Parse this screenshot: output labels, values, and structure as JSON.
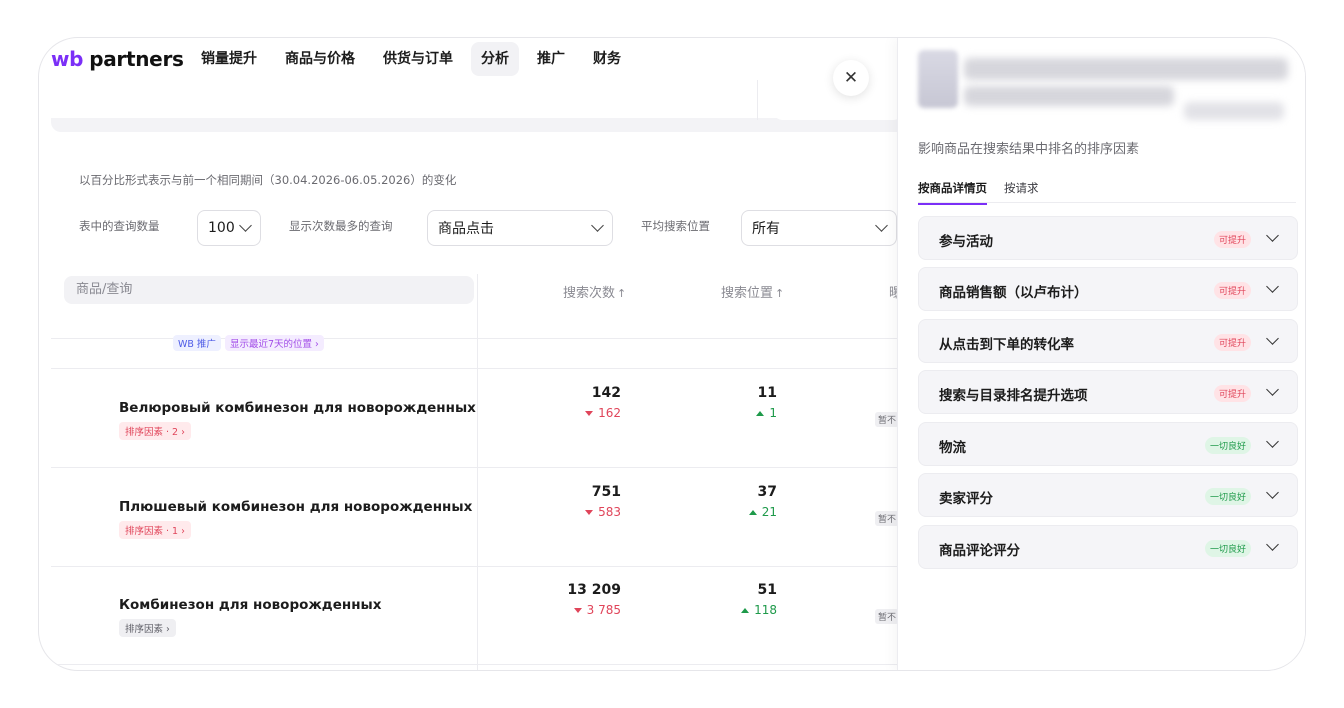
{
  "header": {
    "logo_mark": "wb",
    "logo_text": "partners",
    "nav": [
      "销量提升",
      "商品与价格",
      "供货与订单",
      "分析",
      "推广",
      "财务"
    ],
    "active_nav": "分析"
  },
  "filters": {
    "period_note": "以百分比形式表示与前一个相同期间（30.04.2026-06.05.2026）的变化",
    "rows_label": "表中的查询数量",
    "rows_value": "100",
    "top_label": "显示次数最多的查询",
    "top_value": "商品点击",
    "position_label": "平均搜索位置",
    "position_value": "所有"
  },
  "table": {
    "search_placeholder": "商品/查询",
    "col_searches": "搜索次数",
    "col_position": "搜索位置",
    "col_partial": "曝",
    "sort_arrow": "↑",
    "partial_tags": [
      "WB 推广",
      "显示最近7天的位置 ›"
    ],
    "rows": [
      {
        "name": "Велюровый комбинезон для новорожденных",
        "tag": "排序因素 · 2",
        "tag_color": "red",
        "searches": "142",
        "searches_delta": "162",
        "searches_dir": "down",
        "position": "11",
        "position_delta": "1",
        "position_dir": "up",
        "cut": "暂不"
      },
      {
        "name": "Плюшевый комбинезон для новорожденных",
        "tag": "排序因素 · 1",
        "tag_color": "red",
        "searches": "751",
        "searches_delta": "583",
        "searches_dir": "down",
        "position": "37",
        "position_delta": "21",
        "position_dir": "up",
        "cut": "暂不"
      },
      {
        "name": "Комбинезон для новорожденных",
        "tag": "排序因素",
        "tag_color": "grey",
        "searches": "13 209",
        "searches_delta": "3 785",
        "searches_dir": "down",
        "position": "51",
        "position_delta": "118",
        "position_dir": "up",
        "cut": "暂不"
      }
    ]
  },
  "panel": {
    "close_symbol": "✕",
    "subtitle": "影响商品在搜索结果中排名的排序因素",
    "tabs": [
      "按商品详情页",
      "按请求"
    ],
    "active_tab": "按商品详情页",
    "factors": [
      {
        "title": "参与活动",
        "badge": "可提升",
        "status": "red"
      },
      {
        "title": "商品销售额（以卢布计）",
        "badge": "可提升",
        "status": "red"
      },
      {
        "title": "从点击到下单的转化率",
        "badge": "可提升",
        "status": "red"
      },
      {
        "title": "搜索与目录排名提升选项",
        "badge": "可提升",
        "status": "red"
      },
      {
        "title": "物流",
        "badge": "一切良好",
        "status": "green"
      },
      {
        "title": "卖家评分",
        "badge": "一切良好",
        "status": "green"
      },
      {
        "title": "商品评论评分",
        "badge": "一切良好",
        "status": "green"
      }
    ]
  },
  "colors": {
    "accent": "#7b2ff7",
    "negative": "#e0455a",
    "positive": "#1e9a4a"
  }
}
